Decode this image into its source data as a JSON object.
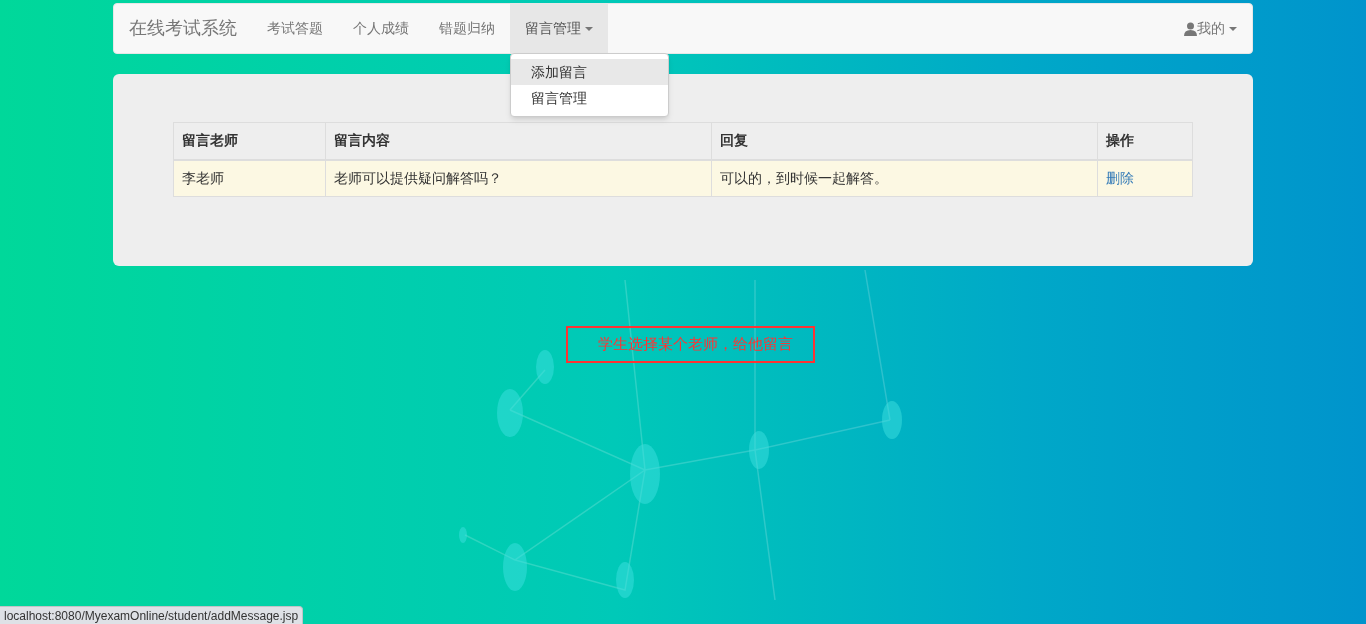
{
  "navbar": {
    "brand": "在线考试系统",
    "items": [
      {
        "label": "考试答题",
        "selected": false,
        "dropdown": false
      },
      {
        "label": "个人成绩",
        "selected": false,
        "dropdown": false
      },
      {
        "label": "错题归纳",
        "selected": false,
        "dropdown": false
      },
      {
        "label": "留言管理",
        "selected": true,
        "dropdown": true
      }
    ],
    "user_menu": {
      "label": "我的"
    }
  },
  "dropdown_menu": {
    "expanded": true,
    "items": [
      {
        "label": "添加留言",
        "selected": true
      },
      {
        "label": "留言管理",
        "selected": false
      }
    ]
  },
  "table": {
    "columns": [
      "留言老师",
      "留言内容",
      "回复",
      "操作"
    ],
    "rows": [
      {
        "cells": [
          "李老师",
          "老师可以提供疑问解答吗？",
          "可以的，到时候一起解答。"
        ],
        "action": "删除"
      }
    ]
  },
  "annotation": "学生选择某个老师，给他留言",
  "status_bar": "localhost:8080/MyexamOnline/student/addMessage.jsp"
}
